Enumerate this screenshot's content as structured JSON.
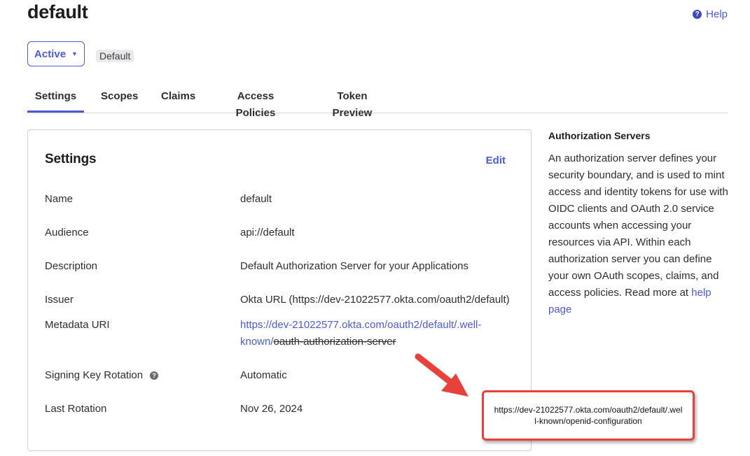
{
  "header": {
    "title": "default",
    "help_label": "Help"
  },
  "status": {
    "selected": "Active",
    "badge": "Default"
  },
  "tabs": [
    {
      "label": "Settings",
      "active": true
    },
    {
      "label": "Scopes"
    },
    {
      "label": "Claims"
    },
    {
      "label": "Access Policies"
    },
    {
      "label": "Token Preview"
    }
  ],
  "settings": {
    "title": "Settings",
    "edit_label": "Edit",
    "rows": [
      {
        "label": "Name",
        "value": "default"
      },
      {
        "label": "Audience",
        "value": "api://default"
      },
      {
        "label": "Description",
        "value": "Default Authorization Server for your Applications"
      },
      {
        "label": "Issuer",
        "value": "Okta URL (https://dev-21022577.okta.com/oauth2/default)"
      },
      {
        "label": "Metadata URI",
        "value_link": "https://dev-21022577.okta.com/oauth2/default/.well-known/",
        "value_struck": "oauth-authorization-server "
      },
      {
        "label": "Signing Key Rotation",
        "value": "Automatic"
      },
      {
        "label": "Last Rotation",
        "value": "Nov 26, 2024"
      }
    ]
  },
  "sidebar": {
    "title": "Authorization Servers",
    "text": "An authorization server defines your security boundary, and is used to mint access and identity tokens for use with OIDC clients and OAuth 2.0 service accounts when accessing your resources via API. Within each authorization server you can define your own OAuth scopes, claims, and access policies. Read more at ",
    "link_label": "help page"
  },
  "annotation": {
    "text": "https://dev-21022577.okta.com/oauth2/default/.well-known/openid-configuration",
    "color": "#e8403b"
  }
}
